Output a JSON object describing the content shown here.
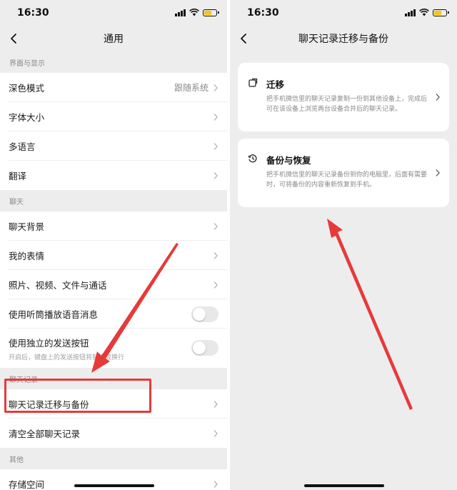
{
  "left": {
    "status": {
      "time": "16:30"
    },
    "title": "通用",
    "sections": [
      {
        "header": "界面与显示",
        "rows": [
          {
            "label": "深色模式",
            "value": "跟随系统"
          },
          {
            "label": "字体大小"
          },
          {
            "label": "多语言"
          },
          {
            "label": "翻译"
          }
        ]
      },
      {
        "header": "聊天",
        "rows": [
          {
            "label": "聊天背景"
          },
          {
            "label": "我的表情"
          },
          {
            "label": "照片、视频、文件与通话"
          },
          {
            "label": "使用听筒播放语音消息"
          },
          {
            "label": "使用独立的发送按钮",
            "sub": "开启后，键盘上的发送按钮将替换成换行"
          }
        ]
      },
      {
        "header": "聊天记录",
        "rows": [
          {
            "label": "聊天记录迁移与备份"
          },
          {
            "label": "清空全部聊天记录"
          }
        ]
      },
      {
        "header": "其他",
        "rows": [
          {
            "label": "存储空间"
          }
        ]
      }
    ]
  },
  "right": {
    "status": {
      "time": "16:30"
    },
    "title": "聊天记录迁移与备份",
    "cards": [
      {
        "title": "迁移",
        "desc": "把手机微信里的聊天记录复制一份到其他设备上，完成后可在该设备上浏览两台设备合并后的聊天记录。"
      },
      {
        "title": "备份与恢复",
        "desc": "把手机微信里的聊天记录备份到你的电脑里，后面有需要时，可将备份的内容重新恢复到手机。"
      }
    ]
  },
  "colors": {
    "background": "#ededed",
    "highlight": "#e63a3a",
    "battery": "#f5c518"
  },
  "icons": [
    "back-chevron-icon",
    "chevron-right-icon",
    "signal-icon",
    "wifi-icon",
    "battery-icon",
    "migrate-icon",
    "clock-backup-icon"
  ]
}
